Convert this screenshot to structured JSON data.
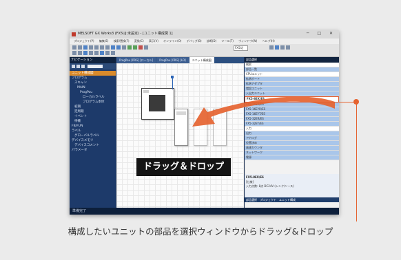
{
  "window": {
    "title": "MELSOFT GX Works3 (FX5UJ:未設定) - [ユニット構成図 1]",
    "controls": "─ □ ✕"
  },
  "menu": {
    "items": [
      "プロジェクト(P)",
      "編集(E)",
      "検索/置換(F)",
      "変換(C)",
      "表示(V)",
      "オンライン(O)",
      "デバッグ(B)",
      "診断(D)",
      "ツール(T)",
      "ウィンドウ(W)",
      "ヘルプ(H)"
    ]
  },
  "toolbar": {
    "combo_text": "FX5UJ"
  },
  "navigation": {
    "header": "ナビゲーション",
    "tree": [
      "ユニット構成図",
      "プログラム",
      "スキャン",
      "MAIN",
      "ProgPou",
      "ローカルラベル",
      "プログラム本体",
      "初期",
      "定周期",
      "イベント",
      "待機",
      "FB/FUN",
      "ラベル",
      "グローバルラベル",
      "デバイスメモリ",
      "デバイスコメント",
      "パラメータ"
    ]
  },
  "editor": {
    "tabs": [
      "ProgPou [PRG] [ローカル]",
      "ProgPou [PRG] [LD]",
      "ユニット構成図"
    ]
  },
  "parts_selection": {
    "header": "部品選択",
    "rows": [
      "検索",
      "部品一覧",
      "CPUユニット",
      "拡張ボード",
      "拡張アダプタ",
      "増設ユニット",
      "入出力ユニット",
      "FX5-16EX/ES",
      "FX5-16EYR/ES",
      "FX5-16EYT/ES",
      "FX5-32ER/ES",
      "FX5-32ET/ES",
      "入力",
      "出力",
      "アナログ",
      "位置決め",
      "高速カウンタ",
      "ネットワーク",
      "電源"
    ],
    "highlighted_row": "FX5-8EX/ES",
    "footer_title": "FX5-8EX/ES",
    "footer_lines": [
      "[仕様]",
      "入力点数: 8点 DC24V (シンク/ソース)",
      "部品選択",
      "プロジェクト",
      "ユニット構成"
    ]
  },
  "status": {
    "text": "準備完了"
  },
  "callout": {
    "label": "ドラッグ＆ドロップ"
  },
  "caption": "構成したいユニットの部品を選択ウィンドウからドラッグ&ドロップ",
  "colors": {
    "accent_orange": "#e56330",
    "ide_navy": "#1b2f52",
    "selection_blue": "#a9c6ea"
  }
}
